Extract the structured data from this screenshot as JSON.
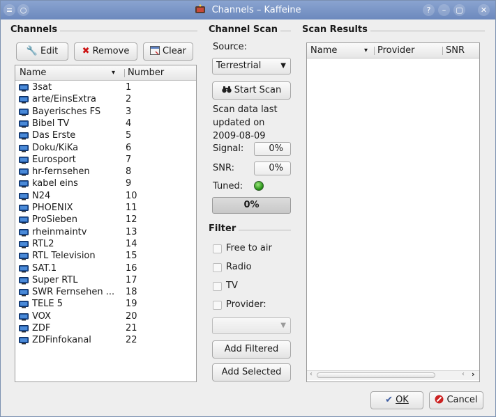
{
  "window": {
    "title": "Channels – Kaffeine",
    "buttons": {
      "help": "?",
      "minimize": "–",
      "maximize": "▢",
      "close": "✕"
    }
  },
  "channels": {
    "section_title": "Channels",
    "edit_label": "Edit",
    "remove_label": "Remove",
    "clear_label": "Clear",
    "columns": {
      "name": "Name",
      "number": "Number"
    },
    "items": [
      {
        "name": "3sat",
        "number": "1"
      },
      {
        "name": "arte/EinsExtra",
        "number": "2"
      },
      {
        "name": "Bayerisches FS",
        "number": "3"
      },
      {
        "name": "Bibel TV",
        "number": "4"
      },
      {
        "name": "Das Erste",
        "number": "5"
      },
      {
        "name": "Doku/KiKa",
        "number": "6"
      },
      {
        "name": "Eurosport",
        "number": "7"
      },
      {
        "name": "hr-fernsehen",
        "number": "8"
      },
      {
        "name": "kabel eins",
        "number": "9"
      },
      {
        "name": "N24",
        "number": "10"
      },
      {
        "name": "PHOENIX",
        "number": "11"
      },
      {
        "name": "ProSieben",
        "number": "12"
      },
      {
        "name": "rheinmaintv",
        "number": "13"
      },
      {
        "name": "RTL2",
        "number": "14"
      },
      {
        "name": "RTL Television",
        "number": "15"
      },
      {
        "name": "SAT.1",
        "number": "16"
      },
      {
        "name": "Super RTL",
        "number": "17"
      },
      {
        "name": "SWR Fernsehen ...",
        "number": "18"
      },
      {
        "name": "TELE 5",
        "number": "19"
      },
      {
        "name": "VOX",
        "number": "20"
      },
      {
        "name": "ZDF",
        "number": "21"
      },
      {
        "name": "ZDFinfokanal",
        "number": "22"
      }
    ]
  },
  "scan": {
    "section_title": "Channel Scan",
    "source_label": "Source:",
    "source_value": "Terrestrial",
    "start_scan_label": "Start Scan",
    "scan_info_line1": "Scan data last",
    "scan_info_line2": "updated on",
    "scan_info_line3": "2009-08-09",
    "signal_label": "Signal:",
    "signal_value": "0%",
    "snr_label": "SNR:",
    "snr_value": "0%",
    "tuned_label": "Tuned:",
    "progress_text": "0%",
    "progress_fraction": 0
  },
  "filter": {
    "section_title": "Filter",
    "free_to_air_label": "Free to air",
    "radio_label": "Radio",
    "tv_label": "TV",
    "provider_label": "Provider:",
    "provider_value": "",
    "add_filtered_label": "Add Filtered",
    "add_selected_label": "Add Selected"
  },
  "results": {
    "section_title": "Scan Results",
    "columns": {
      "name": "Name",
      "provider": "Provider",
      "snr": "SNR"
    }
  },
  "dialog": {
    "ok_label": "OK",
    "cancel_label": "Cancel"
  },
  "colors": {
    "accent": "#6c89bd",
    "tuned_led": "#1f8a10",
    "remove_icon": "#cc1111",
    "cancel_icon": "#cc2222"
  }
}
